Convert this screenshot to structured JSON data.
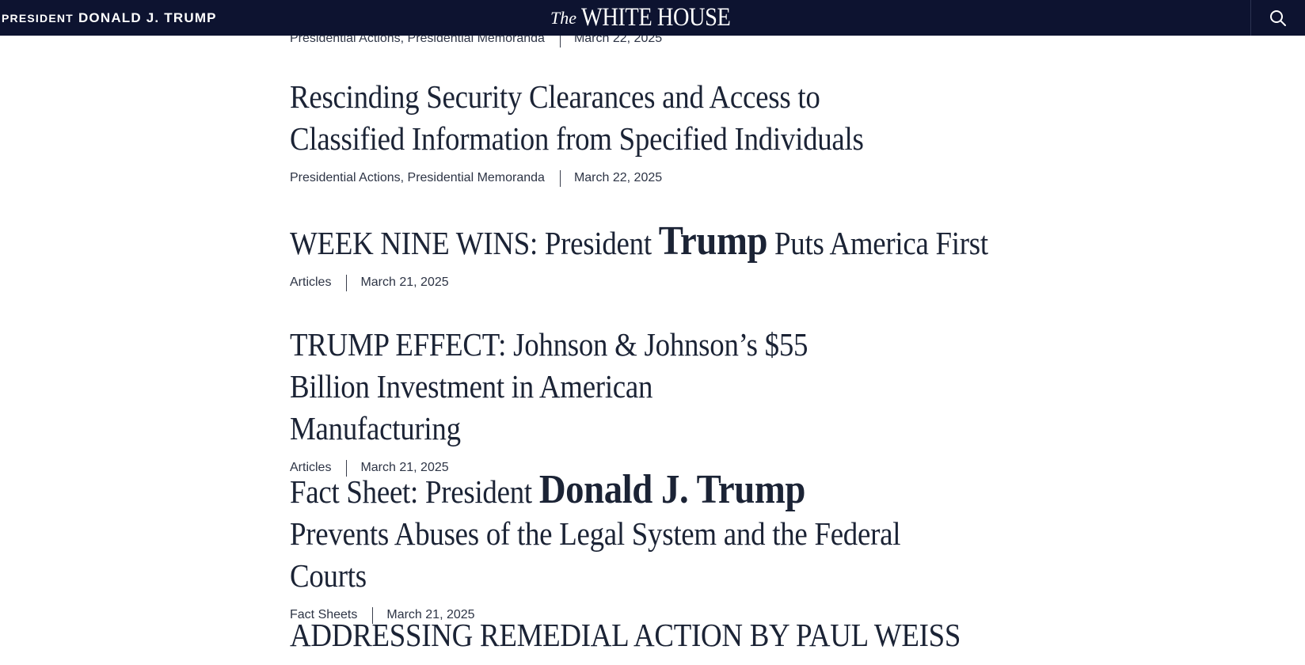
{
  "header": {
    "brand_small": "PRESIDENT",
    "brand_name": "DONALD J. TRUMP",
    "logo_the": "The",
    "logo_main": "WHITE HOUSE",
    "search_icon": "search-icon"
  },
  "feed": {
    "items": [
      {
        "headline": "",
        "categories": "Presidential Actions, Presidential Memoranda",
        "date": "March 22, 2025"
      },
      {
        "headline": "Rescinding Security Clearances and Access to Classified Information from Specified Individuals",
        "categories": "Presidential Actions, Presidential Memoranda",
        "date": "March 22, 2025"
      },
      {
        "headline_pre": "WEEK NINE WINS: President ",
        "headline_emph": "Trump",
        "headline_post": " Puts America First",
        "categories": "Articles",
        "date": "March 21, 2025"
      },
      {
        "headline": "TRUMP EFFECT: Johnson & Johnson’s $55 Billion Investment in American Manufacturing",
        "categories": "Articles",
        "date": "March 21, 2025"
      },
      {
        "headline_pre": "Fact Sheet: President ",
        "headline_emph": "Donald J. Trump",
        "headline_post": " Prevents Abuses of the Legal System and the Federal Courts",
        "categories": "Fact Sheets",
        "date": "March 21, 2025"
      },
      {
        "headline": "ADDRESSING REMEDIAL ACTION BY PAUL WEISS"
      }
    ]
  }
}
